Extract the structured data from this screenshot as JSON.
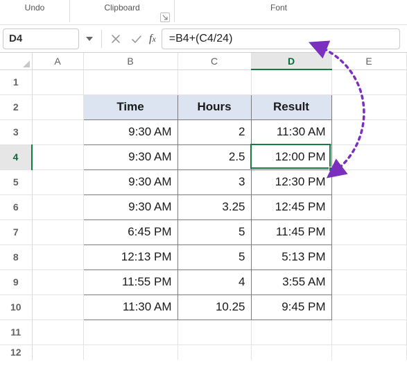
{
  "ribbon": {
    "groups": {
      "undo": "Undo",
      "clipboard": "Clipboard",
      "font": "Font"
    }
  },
  "namebox": {
    "value": "D4"
  },
  "formula": {
    "value": "=B4+(C4/24)"
  },
  "columns": [
    "A",
    "B",
    "C",
    "D",
    "E"
  ],
  "rows": [
    "1",
    "2",
    "3",
    "4",
    "5",
    "6",
    "7",
    "8",
    "9",
    "10",
    "11",
    "12"
  ],
  "headers": {
    "time": "Time",
    "hours": "Hours",
    "result": "Result"
  },
  "data": [
    {
      "time": "9:30 AM",
      "hours": "2",
      "result": "11:30 AM"
    },
    {
      "time": "9:30 AM",
      "hours": "2.5",
      "result": "12:00 PM"
    },
    {
      "time": "9:30 AM",
      "hours": "3",
      "result": "12:30 PM"
    },
    {
      "time": "9:30 AM",
      "hours": "3.25",
      "result": "12:45 PM"
    },
    {
      "time": "6:45 PM",
      "hours": "5",
      "result": "11:45 PM"
    },
    {
      "time": "12:13 PM",
      "hours": "5",
      "result": "5:13 PM"
    },
    {
      "time": "11:55 PM",
      "hours": "4",
      "result": "3:55 AM"
    },
    {
      "time": "11:30 AM",
      "hours": "10.25",
      "result": "9:45 PM"
    }
  ],
  "active_cell": "D4",
  "colors": {
    "accent": "#107c41",
    "header_fill": "#dce4f2",
    "anno": "#7b2fbf"
  },
  "chart_data": {
    "type": "table",
    "title": "",
    "columns": [
      "Time",
      "Hours",
      "Result"
    ],
    "rows": [
      [
        "9:30 AM",
        2,
        "11:30 AM"
      ],
      [
        "9:30 AM",
        2.5,
        "12:00 PM"
      ],
      [
        "9:30 AM",
        3,
        "12:30 PM"
      ],
      [
        "9:30 AM",
        3.25,
        "12:45 PM"
      ],
      [
        "6:45 PM",
        5,
        "11:45 PM"
      ],
      [
        "12:13 PM",
        5,
        "5:13 PM"
      ],
      [
        "11:55 PM",
        4,
        "3:55 AM"
      ],
      [
        "11:30 AM",
        10.25,
        "9:45 PM"
      ]
    ]
  }
}
